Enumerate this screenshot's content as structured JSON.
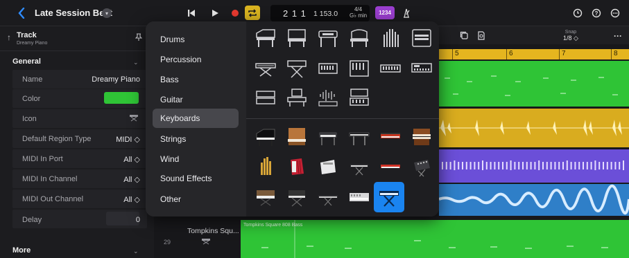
{
  "project": {
    "title": "Late Session Beat"
  },
  "transport": {
    "position": "2 1 1",
    "tempo": "1  153.0",
    "time_sig_top": "4/4",
    "time_sig_bottom": "G♭ min",
    "count_in": "1234"
  },
  "inspector": {
    "track_label": "Track",
    "track_sub": "Dreamy Piano",
    "general_title": "General",
    "rows": [
      {
        "label": "Name",
        "value": "Dreamy Piano"
      },
      {
        "label": "Color",
        "value": ""
      },
      {
        "label": "Icon",
        "value": ""
      },
      {
        "label": "Default Region Type",
        "value": "MIDI ◇"
      },
      {
        "label": "MIDI In Port",
        "value": "All ◇"
      },
      {
        "label": "MIDI In Channel",
        "value": "All ◇"
      },
      {
        "label": "MIDI Out Channel",
        "value": "All ◇"
      },
      {
        "label": "Delay",
        "value": "0"
      }
    ],
    "more_title": "More",
    "color_value": "#2fc436"
  },
  "timeline": {
    "bars": [
      "5",
      "6",
      "7",
      "8"
    ],
    "snap_label": "Snap",
    "snap_value": "1/8 ◇",
    "track_name": "Tompkins Squ...",
    "track_number": "29",
    "region_name": "Tompkins Square 808 Bass"
  },
  "icon_picker": {
    "categories": [
      "Drums",
      "Percussion",
      "Bass",
      "Guitar",
      "Keyboards",
      "Strings",
      "Wind",
      "Sound Effects",
      "Other"
    ],
    "selected_category": "Keyboards",
    "outline_icons": [
      "grand-piano-icon",
      "upright-piano-icon",
      "electric-piano-icon",
      "spinet-piano-icon",
      "organ-pipes-icon",
      "organ-console-icon",
      "keytar-icon",
      "synth-on-stand-icon",
      "keyboard-rack-icon",
      "modular-synth-icon",
      "mini-keyboard-icon",
      "compact-keyboard-icon",
      "two-tier-keyboard-icon",
      "workstation-icon",
      "sampler-waveform-icon",
      "controller-keyboard-icon"
    ],
    "photo_icons": [
      "grand-piano-photo-icon",
      "upright-wood-piano-photo-icon",
      "electric-piano-photo-icon",
      "stage-piano-photo-icon",
      "red-synth-photo-icon",
      "wood-organ-photo-icon",
      "pipe-organ-photo-icon",
      "accordion-photo-icon",
      "amp-photo-icon",
      "digital-keyboard-photo-icon",
      "red-keyboard-photo-icon",
      "drum-machine-photo-icon",
      "vintage-synth-photo-icon",
      "synth-stand-photo-icon",
      "synth-dark-photo-icon",
      "silver-synth-photo-icon",
      "keyboard-stand-selected-icon"
    ],
    "selected_icon": "keyboard-stand-selected-icon"
  },
  "colors": {
    "accent_blue": "#1a84f0",
    "region_green": "#2fc436",
    "region_yellow": "#d9ac1f",
    "region_purple": "#6b4fd8",
    "region_blue": "#2f7fc8"
  }
}
